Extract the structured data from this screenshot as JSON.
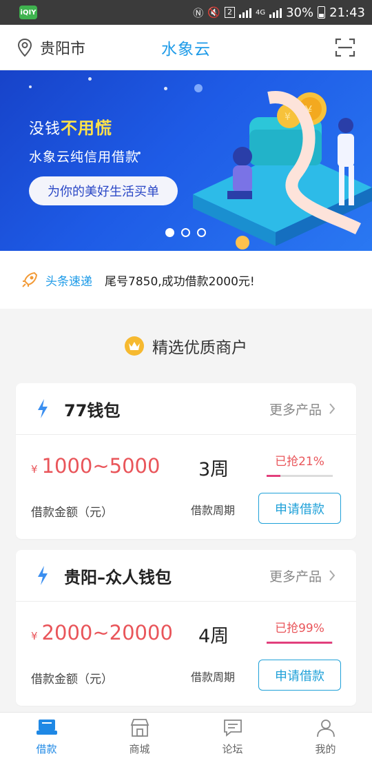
{
  "status_bar": {
    "app_badge": "iQIY",
    "network": "4G",
    "sim_badge": "2",
    "battery": "30%",
    "time": "21:43"
  },
  "header": {
    "location": "贵阳市",
    "title": "水象云"
  },
  "banner": {
    "line1_prefix": "没钱",
    "line1_highlight": "不用慌",
    "line2": "水象云纯信用借款",
    "cta": "为你的美好生活买单",
    "active_slide": 1,
    "slide_count": 3
  },
  "ticker": {
    "tag": "头条速递",
    "text": "尾号7850,成功借款2000元!"
  },
  "section": {
    "title": "精选优质商户"
  },
  "products": [
    {
      "name": "77钱包",
      "more": "更多产品",
      "currency": "¥",
      "amount": "1000~5000",
      "period": "3周",
      "grab_text": "已抢21%",
      "grab_fraction": 0.21,
      "amount_label": "借款金额（元）",
      "period_label": "借款周期",
      "apply": "申请借款"
    },
    {
      "name": "贵阳–众人钱包",
      "more": "更多产品",
      "currency": "¥",
      "amount": "2000~20000",
      "period": "4周",
      "grab_text": "已抢99%",
      "grab_fraction": 0.99,
      "amount_label": "借款金额（元）",
      "period_label": "借款周期",
      "apply": "申请借款"
    }
  ],
  "tabbar": {
    "tabs": [
      {
        "label": "借款",
        "icon": "loan-icon",
        "active": true
      },
      {
        "label": "商城",
        "icon": "shop-icon",
        "active": false
      },
      {
        "label": "论坛",
        "icon": "forum-icon",
        "active": false
      },
      {
        "label": "我的",
        "icon": "profile-icon",
        "active": false
      }
    ]
  },
  "colors": {
    "accent": "#1e9be8",
    "price": "#e9555a",
    "progress": "#e23f7c",
    "banner": "#1e5be6"
  }
}
